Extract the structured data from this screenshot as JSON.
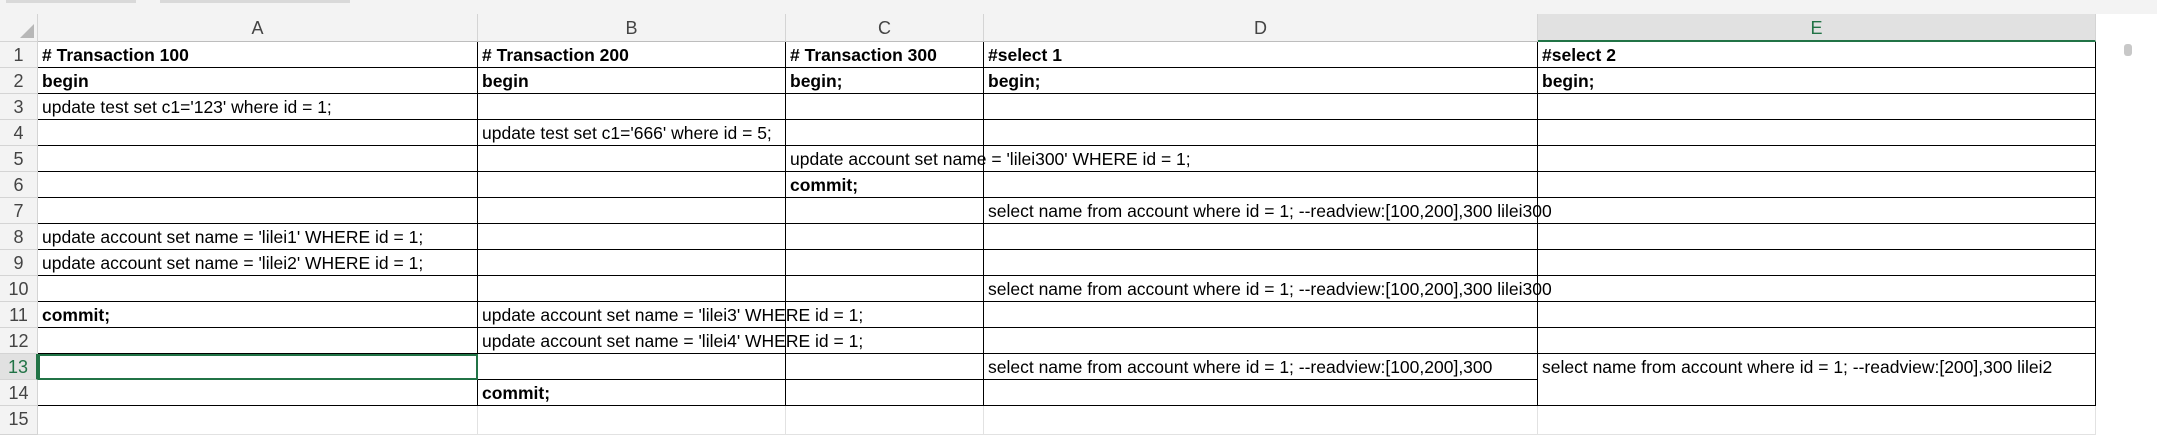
{
  "columns": [
    "A",
    "B",
    "C",
    "D",
    "E"
  ],
  "selected_column": "E",
  "rows": [
    "1",
    "2",
    "3",
    "4",
    "5",
    "6",
    "7",
    "8",
    "9",
    "10",
    "11",
    "12",
    "13",
    "14",
    "15"
  ],
  "selected_row": "13",
  "cells": {
    "A1": "# Transaction 100",
    "B1": "# Transaction 200",
    "C1": "# Transaction 300",
    "D1": "#select 1",
    "E1": "#select 2",
    "A2": "begin",
    "B2": "begin",
    "C2": "begin;",
    "D2": "begin;",
    "E2": "begin;",
    "A3": "update test set c1='123' where id = 1;",
    "B4": "update test set c1='666' where id = 5;",
    "C5": "update account set name = 'lilei300' WHERE id = 1;",
    "C6": "commit;",
    "D7": "select name from account  where id = 1;  --readview:[100,200],300      lilei300",
    "A8": "update account set name = 'lilei1' WHERE id = 1;",
    "A9": "update account set name = 'lilei2' WHERE id = 1;",
    "D10": "select name from account  where id = 1;  --readview:[100,200],300      lilei300",
    "A11": "commit;",
    "B11": "update account set name = 'lilei3' WHERE id = 1;",
    "B12": "update account set name = 'lilei4' WHERE id = 1;",
    "D13": "select name from account  where id = 1;  --readview:[100,200],300",
    "E13": "select name from account  where id = 1;  --readview:[200],300 lilei2",
    "B14": "commit;"
  }
}
